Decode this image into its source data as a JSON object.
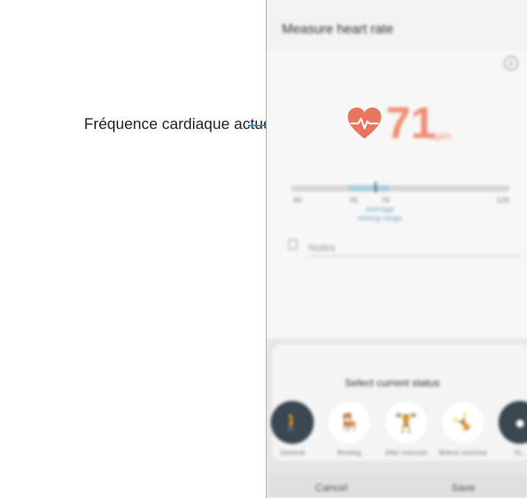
{
  "annotation": {
    "label": "Fréquence cardiaque actuelle"
  },
  "appbar": {
    "title": "Measure heart rate"
  },
  "heart_rate": {
    "value": "71",
    "unit": "bpm",
    "heart_color": "#e8765e",
    "value_color": "#ee8f72"
  },
  "range": {
    "min": "40",
    "low": "61",
    "high": "76",
    "max": "120",
    "current": 71,
    "caption_line1": "Average",
    "caption_line2": "resting range",
    "fill_color": "#a9cde0"
  },
  "notes": {
    "placeholder": "Notes"
  },
  "status": {
    "title": "Select current status",
    "options": [
      {
        "label": "General",
        "icon": "standing-person-icon",
        "selected": true
      },
      {
        "label": "Resting",
        "icon": "sitting-person-icon",
        "selected": false
      },
      {
        "label": "After exercise",
        "icon": "person-after-exercise-icon",
        "selected": false
      },
      {
        "label": "Before exercise",
        "icon": "person-before-exercise-icon",
        "selected": false
      },
      {
        "label": "Tir...",
        "icon": "partial-status-icon",
        "selected": false
      }
    ]
  },
  "footer": {
    "cancel_label": "Cancel",
    "save_label": "Save"
  },
  "colors": {
    "callout_line": "#2b8dc4",
    "selected_status": "#3b4750"
  }
}
